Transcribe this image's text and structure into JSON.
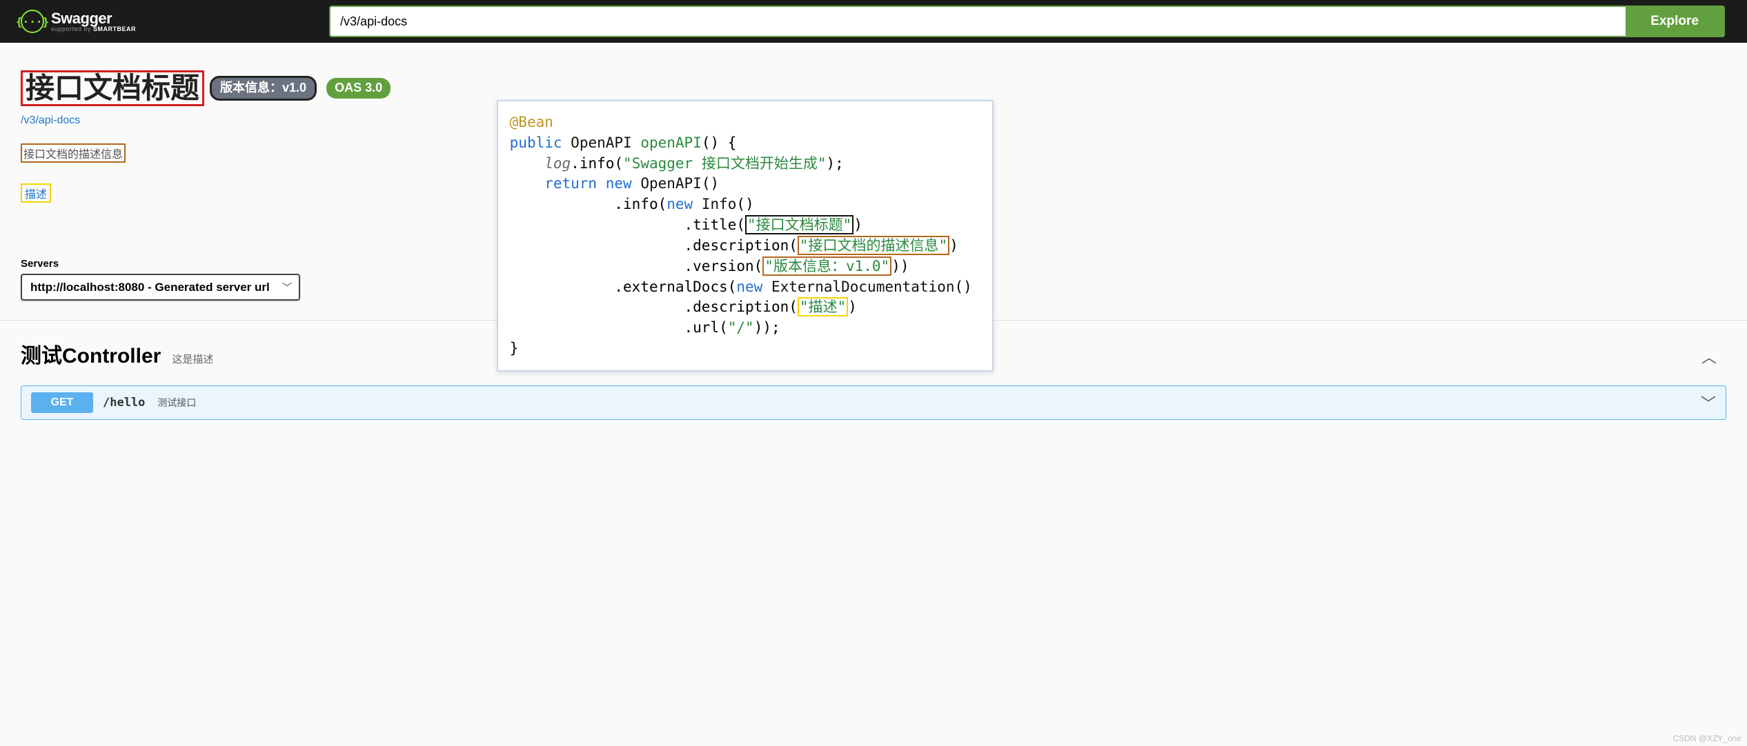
{
  "topbar": {
    "brand_name": "Swagger",
    "brand_sub_prefix": "supported by ",
    "brand_sub_bold": "SMARTBEAR",
    "brand_glyph": "{···}",
    "search_value": "/v3/api-docs",
    "explore_label": "Explore"
  },
  "info": {
    "title": "接口文档标题",
    "version_badge": "版本信息：v1.0",
    "oas_badge": "OAS 3.0",
    "docs_link": "/v3/api-docs",
    "description": "接口文档的描述信息",
    "external_desc": "描述"
  },
  "servers": {
    "label": "Servers",
    "selected": "http://localhost:8080 - Generated server url"
  },
  "tag": {
    "name": "测试Controller",
    "desc": "这是描述"
  },
  "operation": {
    "method": "GET",
    "path": "/hello",
    "summary": "测试接口"
  },
  "code": {
    "ann": "@Bean",
    "kw_public": "public",
    "kw_return": "return",
    "kw_new": "new",
    "t_OpenAPI": "OpenAPI",
    "t_Info": "Info",
    "t_ExternalDocumentation": "ExternalDocumentation",
    "fn_openAPI": "openAPI",
    "fn_info_log": "info",
    "fn_info": "info",
    "fn_title": "title",
    "fn_description": "description",
    "fn_version": "version",
    "fn_externalDocs": "externalDocs",
    "fn_url": "url",
    "var_log": "log",
    "s_log": "\"Swagger 接口文档开始生成\"",
    "s_title": "\"接口文档标题\"",
    "s_desc": "\"接口文档的描述信息\"",
    "s_version": "\"版本信息：v1.0\"",
    "s_extdesc": "\"描述\"",
    "s_url": "\"/\""
  },
  "watermark": "CSDN @XZY_one"
}
